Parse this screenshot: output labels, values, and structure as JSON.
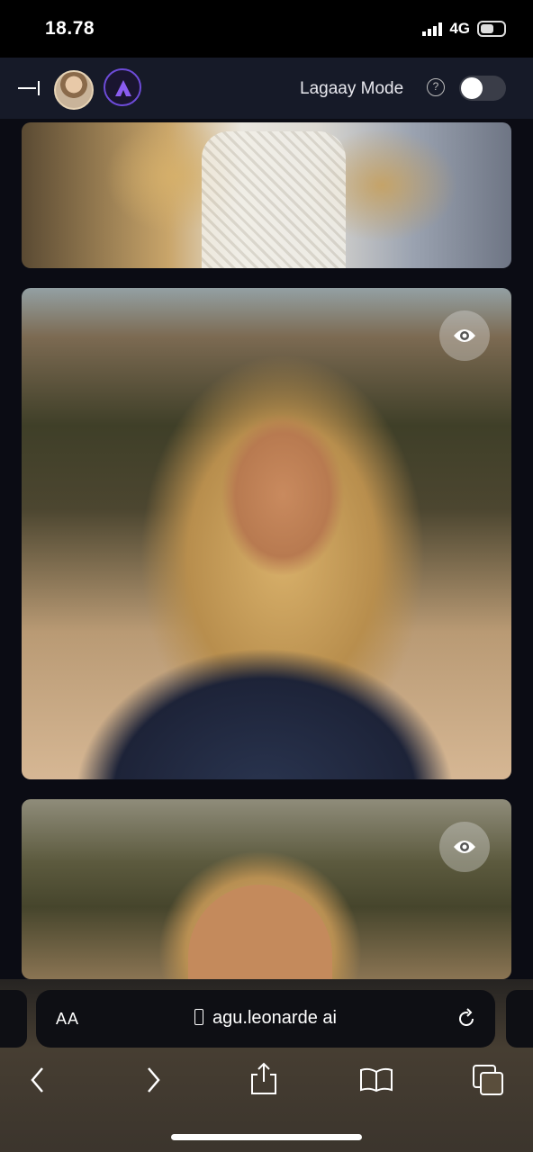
{
  "status_bar": {
    "time": "18.78",
    "network": "4G"
  },
  "header": {
    "mode_label": "Lagaay Mode",
    "help_glyph": "?",
    "toggle_state": "off"
  },
  "cards": [
    {
      "name": "image-card-1"
    },
    {
      "name": "image-card-2",
      "action_icon": "eye-icon"
    },
    {
      "name": "image-card-3",
      "action_icon": "eye-icon"
    }
  ],
  "browser": {
    "aa_label": "AA",
    "url": "agu.leonarde ai"
  },
  "colors": {
    "header_bg": "#161a28",
    "accent": "#6d4bd8",
    "page_bg": "#0b0c14"
  }
}
